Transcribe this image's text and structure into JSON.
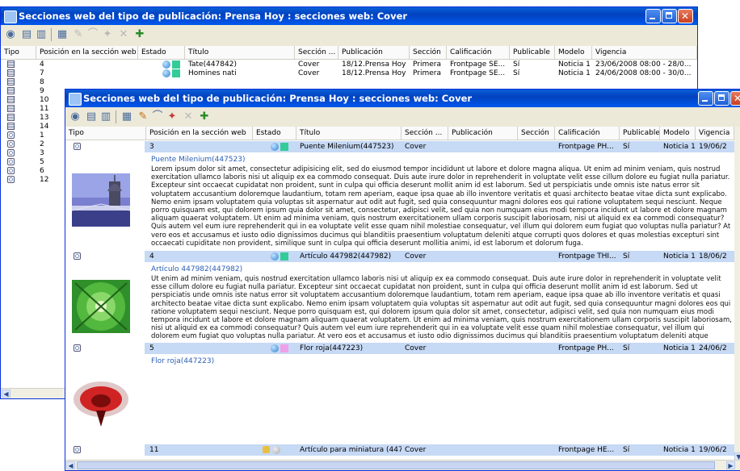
{
  "back_window": {
    "title": "Secciones web del tipo de publicación: Prensa Hoy : secciones web: Cover",
    "columns": [
      "Tipo",
      "Posición en la sección web",
      "Estado",
      "Título",
      "Sección ...",
      "Publicación",
      "Sección",
      "Calificación",
      "Publicable",
      "Modelo",
      "Vigencia"
    ],
    "rows": [
      {
        "pos": "4",
        "titulo": "Tate(447842)",
        "seccion": "Cover",
        "publicacion": "18/12.Prensa Hoy",
        "seccion2": "Primera",
        "calificacion": "Frontpage SE...",
        "publicable": "Sí",
        "modelo": "Noticia 1",
        "vigencia": "23/06/2008 08:00 - 28/0..."
      },
      {
        "pos": "7",
        "titulo": "Homines nati",
        "seccion": "Cover",
        "publicacion": "18/12.Prensa Hoy",
        "seccion2": "Primera",
        "calificacion": "Frontpage SE...",
        "publicable": "Sí",
        "modelo": "Noticia 1",
        "vigencia": "24/06/2008 08:00 - 30/0..."
      }
    ],
    "more_positions": [
      "8",
      "9",
      "10",
      "11",
      "13",
      "14",
      "1",
      "2",
      "3",
      "5",
      "6",
      "12"
    ]
  },
  "front_window": {
    "title": "Secciones web del tipo de publicación: Prensa Hoy : secciones web: Cover",
    "columns": [
      "Tipo",
      "Posición en la sección web",
      "Estado",
      "Título",
      "Sección ...",
      "Publicación",
      "Sección",
      "Calificación",
      "Publicable",
      "Modelo",
      "Vigencia"
    ],
    "items": [
      {
        "pos": "3",
        "titulo": "Puente Milenium(447523)",
        "seccion": "Cover",
        "calificacion": "Frontpage PH...",
        "publicable": "Sí",
        "modelo": "Noticia 1",
        "vigencia": "19/06/2",
        "headline": "Puente Milenium(447523)",
        "body": "Lorem ipsum dolor sit amet, consectetur adipisicing elit, sed do eiusmod tempor incididunt ut labore et dolore magna aliqua. Ut enim ad minim veniam, quis nostrud exercitation ullamco laboris nisi ut aliquip ex ea commodo consequat. Duis aute irure dolor in reprehenderit in voluptate velit esse cillum dolore eu fugiat nulla pariatur. Excepteur sint occaecat cupidatat non proident, sunt in culpa qui officia deserunt mollit anim id est laborum. Sed ut perspiciatis unde omnis iste natus error sit voluptatem accusantium doloremque laudantium, totam rem aperiam, eaque ipsa quae ab illo inventore veritatis et quasi architecto beatae vitae dicta sunt explicabo. Nemo enim ipsam voluptatem quia voluptas sit aspernatur aut odit aut fugit, sed quia consequuntur magni dolores eos qui ratione voluptatem sequi nesciunt. Neque porro quisquam est, qui dolorem ipsum quia dolor sit amet, consectetur, adipisci velit, sed quia non numquam eius modi tempora incidunt ut labore et dolore magnam aliquam quaerat voluptatem. Ut enim ad minima veniam, quis nostrum exercitationem ullam corporis suscipit laboriosam, nisi ut aliquid ex ea commodi consequatur? Quis autem vel eum iure reprehenderit qui in ea voluptate velit esse quam nihil molestiae consequatur, vel illum qui dolorem eum fugiat quo voluptas nulla pariatur? At vero eos et accusamus et iusto odio dignissimos ducimus qui blanditiis praesentium voluptatum deleniti atque corrupti quos dolores et quas molestias excepturi sint occaecati cupiditate non provident, similique sunt in culpa qui officia deserunt mollitia animi, id est laborum et dolorum fuga.",
        "status_color": "#33cc99"
      },
      {
        "pos": "4",
        "titulo": "Artículo 447982(447982)",
        "seccion": "Cover",
        "calificacion": "Frontpage THI...",
        "publicable": "Sí",
        "modelo": "Noticia 1",
        "vigencia": "18/06/2",
        "headline": "Artículo 447982(447982)",
        "body": "Ut enim ad minim veniam, quis nostrud exercitation ullamco laboris nisi ut aliquip ex ea commodo consequat. Duis aute irure dolor in reprehenderit in voluptate velit esse cillum dolore eu fugiat nulla pariatur. Excepteur sint occaecat cupidatat non proident, sunt in culpa qui officia deserunt mollit anim id est laborum. Sed ut perspiciatis unde omnis iste natus error sit voluptatem accusantium doloremque laudantium, totam rem aperiam, eaque ipsa quae ab illo inventore veritatis et quasi architecto beatae vitae dicta sunt explicabo. Nemo enim ipsam voluptatem quia voluptas sit aspernatur aut odit aut fugit, sed quia consequuntur magni dolores eos qui ratione voluptatem sequi nesciunt. Neque porro quisquam est, qui dolorem ipsum quia dolor sit amet, consectetur, adipisci velit, sed quia non numquam eius modi tempora incidunt ut labore et dolore magnam aliquam quaerat voluptatem. Ut enim ad minima veniam, quis nostrum exercitationem ullam corporis suscipit laboriosam, nisi ut aliquid ex ea commodi consequatur? Quis autem vel eum iure reprehenderit qui in ea voluptate velit esse quam nihil molestiae consequatur, vel illum qui dolorem eum fugiat quo voluptas nulla pariatur. At vero eos et accusamus et iusto odio dignissimos ducimus qui blanditiis praesentium voluptatum deleniti atque corrupti quos dolores et quas molestias excepturi sint occaecati cupiditate non provident, similique sunt in culpa qui officia deserunt mollitia animi, id est laborum et dolorum fuga. Et harum quidem rerum facilis est et expedita distinctio. Nam libero tempore,",
        "status_color": "#33cc99"
      },
      {
        "pos": "5",
        "titulo": "Flor roja(447223)",
        "seccion": "Cover",
        "calificacion": "Frontpage PH...",
        "publicable": "Sí",
        "modelo": "Noticia 1",
        "vigencia": "24/06/2",
        "headline": "Flor roja(447223)",
        "body": "",
        "status_color": "#f0a0e8"
      },
      {
        "pos": "11",
        "titulo": "Artículo para miniatura (447...",
        "seccion": "Cover",
        "calificacion": "Frontpage HE...",
        "publicable": "Sí",
        "modelo": "Noticia 1",
        "vigencia": "19/06/2",
        "status_color": "#33cc99"
      }
    ]
  },
  "icons": {
    "toolbar": [
      "view-icon",
      "list-icon",
      "detail-icon",
      "grid-icon",
      "edit-icon",
      "link-icon",
      "publish-icon",
      "delete-icon",
      "add-icon"
    ]
  }
}
